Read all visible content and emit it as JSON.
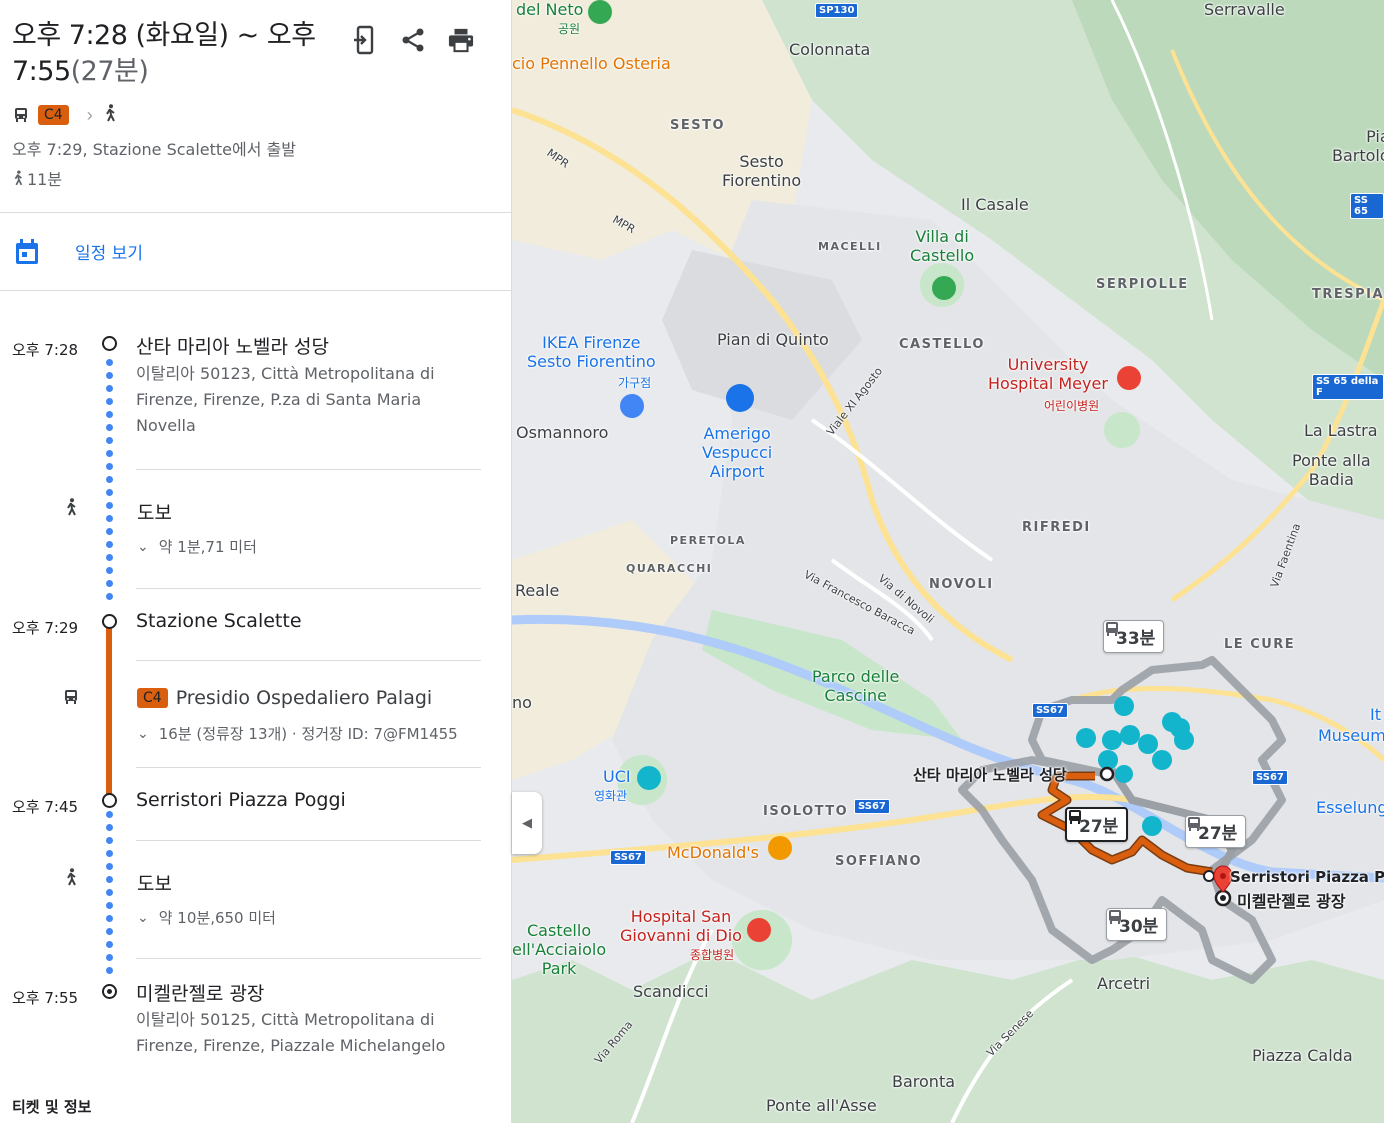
{
  "summary": {
    "time_range": "오후 7:28 (화요일) ~ 오후 7:55",
    "duration": "(27분)",
    "route_badge": "C4",
    "depart_text": "오후 7:29, Stazione Scalette에서 출발",
    "walk_total": "11분"
  },
  "actions": {
    "send_to_phone": "send-to-phone",
    "share": "share",
    "print": "print"
  },
  "schedule": {
    "label": "일정 보기"
  },
  "timeline": {
    "start": {
      "time": "오후 7:28",
      "name": "산타 마리아 노벨라 성당",
      "address_line1": "이탈리아 50123, Città Metropolitana di",
      "address_line2": "Firenze, Firenze, P.za di Santa Maria",
      "address_line3": "Novella"
    },
    "walk1": {
      "label": "도보",
      "detail": "약 1분,71 미터"
    },
    "stop1": {
      "time": "오후 7:29",
      "name": "Stazione Scalette"
    },
    "bus": {
      "badge": "C4",
      "headsign": "Presidio Ospedaliero Palagi",
      "detail": "16분 (정류장 13개) · 정거장 ID: 7@FM1455"
    },
    "stop2": {
      "time": "오후 7:45",
      "name": "Serristori Piazza Poggi"
    },
    "walk2": {
      "label": "도보",
      "detail": "약 10분,650 미터"
    },
    "end": {
      "time": "오후 7:55",
      "name": "미켈란젤로 광장",
      "address_line1": "이탈리아 50125, Città Metropolitana di",
      "address_line2": "Firenze, Firenze, Piazzale Michelangelo"
    }
  },
  "tickets": "티켓 및 정보",
  "map": {
    "labels": {
      "del_neto": "del Neto",
      "park_kr": "공원",
      "serravalle": "Serravalle",
      "colonnata": "Colonnata",
      "pennello": "cio Pennello Osteria",
      "sesto": "SESTO",
      "sesto_fiorentino": "Sesto\nFiorentino",
      "mpr1": "MPR",
      "mpr2": "MPR",
      "il_casale": "Il Casale",
      "macelli": "MACELLI",
      "villa_castello": "Villa di\nCastello",
      "serpiolle": "SERPIOLLE",
      "trespia": "TRESPIA",
      "ikea": "IKEA Firenze\nSesto Fiorentino",
      "furniture_kr": "가구점",
      "pian_di_quinto": "Pian di Quinto",
      "castello": "CASTELLO",
      "university": "University\nHospital Meyer",
      "child_hosp_kr": "어린이병원",
      "osmannoro": "Osmannoro",
      "airport": "Amerigo\nVespucci\nAirport",
      "la_lastra": "La Lastra",
      "ponte_badia": "Ponte alla\nBadia",
      "viale_agosto": "Viale XI Agosto",
      "rifredi": "RIFREDI",
      "peretola": "PERETOLA",
      "quaracchi": "QUARACCHI",
      "reale": "Reale",
      "via_baracca": "Via Francesco Baracca",
      "via_novoli": "Via di Novoli",
      "novoli": "NOVOLI",
      "le_cure": "LE CURE",
      "parco_cascine": "Parco delle\nCascine",
      "no": "no",
      "uci": "UCI",
      "cinema_kr": "영화관",
      "santa_maria": "산타 마리아 노벨라 성당",
      "isolotto": "ISOLOTTO",
      "mcdonalds": "McDonald's",
      "soffiano": "SOFFIANO",
      "serristori": "Serristori Piazza Poggi",
      "michelangelo": "미켈란젤로 광장",
      "hospital_san": "Hospital San\nGiovanni di Dio",
      "general_hosp_kr": "종합병원",
      "castello_park": "Castello\nell'Acciaiolo\nPark",
      "scandicci": "Scandicci",
      "arcetri": "Arcetri",
      "piazza_calda": "Piazza Calda",
      "baronta": "Baronta",
      "ponte_asse": "Ponte all'Asse",
      "via_roma": "Via Roma",
      "via_senese": "Via Senese",
      "museum": "Museum",
      "esselung": "Esselung",
      "it": "It",
      "pia_bartolo": "Pia\nBartolo",
      "via_faentina": "Via Faentina"
    },
    "road_badges": {
      "sp130": "SP130",
      "ss65": "SS 65",
      "ss65_della": "SS 65 della F",
      "ss67_a": "SS67",
      "ss67_b": "SS67",
      "ss67_c": "SS67",
      "ss67_d": "SS67"
    },
    "durations": {
      "d33": "33분",
      "d27_selected": "27분",
      "d27_alt": "27분",
      "d30": "30분"
    },
    "colors": {
      "route_selected": "#d95f0e",
      "route_alt": "#9aa0a6",
      "walk": "#4285f4",
      "water": "#aecbfa",
      "park": "#c8e6c9"
    }
  }
}
